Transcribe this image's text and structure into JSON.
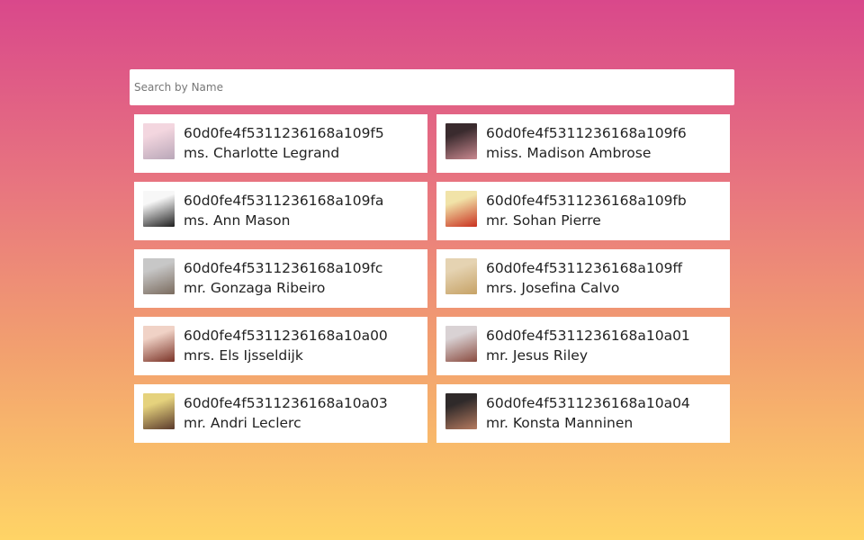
{
  "search": {
    "placeholder": "Search by Name",
    "value": ""
  },
  "users": [
    {
      "id": "60d0fe4f5311236168a109f5",
      "name": "ms. Charlotte Legrand",
      "avatar_colors": [
        "#f3d6df",
        "#b9a7b8"
      ]
    },
    {
      "id": "60d0fe4f5311236168a109f6",
      "name": "miss. Madison Ambrose",
      "avatar_colors": [
        "#3a2b2e",
        "#c9888f"
      ]
    },
    {
      "id": "60d0fe4f5311236168a109fa",
      "name": "ms. Ann Mason",
      "avatar_colors": [
        "#f7f7f7",
        "#1e1e1e"
      ]
    },
    {
      "id": "60d0fe4f5311236168a109fb",
      "name": "mr. Sohan Pierre",
      "avatar_colors": [
        "#f1e3a8",
        "#c9301f"
      ]
    },
    {
      "id": "60d0fe4f5311236168a109fc",
      "name": "mr. Gonzaga Ribeiro",
      "avatar_colors": [
        "#c7c7c7",
        "#7a6b5e"
      ]
    },
    {
      "id": "60d0fe4f5311236168a109ff",
      "name": "mrs. Josefina Calvo",
      "avatar_colors": [
        "#e5d3b2",
        "#c6a266"
      ]
    },
    {
      "id": "60d0fe4f5311236168a10a00",
      "name": "mrs. Els Ijsseldijk",
      "avatar_colors": [
        "#f0d2c6",
        "#7b3327"
      ]
    },
    {
      "id": "60d0fe4f5311236168a10a01",
      "name": "mr. Jesus Riley",
      "avatar_colors": [
        "#d9d2d4",
        "#8a4b3f"
      ]
    },
    {
      "id": "60d0fe4f5311236168a10a03",
      "name": "mr. Andri Leclerc",
      "avatar_colors": [
        "#e5d27d",
        "#5b3a2c"
      ]
    },
    {
      "id": "60d0fe4f5311236168a10a04",
      "name": "mr. Konsta Manninen",
      "avatar_colors": [
        "#2f2a2a",
        "#b57a5f"
      ]
    }
  ]
}
